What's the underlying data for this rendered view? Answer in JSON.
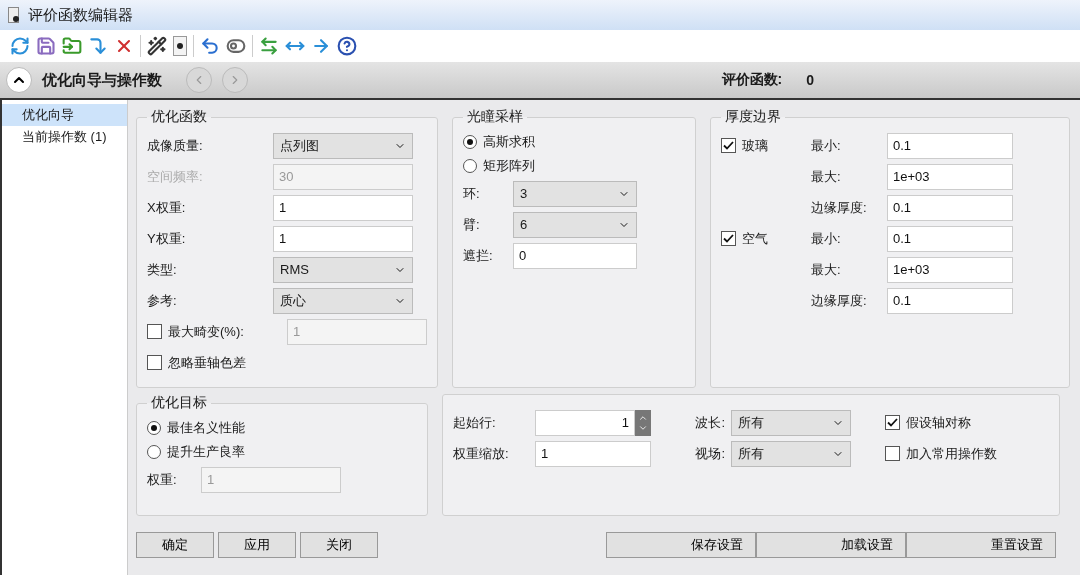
{
  "window": {
    "title": "评价函数编辑器"
  },
  "header": {
    "expanded": true,
    "title": "优化向导与操作数",
    "merit_label": "评价函数:",
    "merit_value": "0"
  },
  "sidebar": {
    "items": [
      {
        "label": "优化向导",
        "selected": true
      },
      {
        "label": "当前操作数 (1)",
        "selected": false
      }
    ]
  },
  "optimization_function": {
    "title": "优化函数",
    "rows": [
      {
        "kind": "select",
        "label": "成像质量:",
        "value": "点列图",
        "disabled": false
      },
      {
        "kind": "input",
        "label": "空间频率:",
        "value": "30",
        "disabled": true
      },
      {
        "kind": "input",
        "label": "X权重:",
        "value": "1",
        "disabled": false
      },
      {
        "kind": "input",
        "label": "Y权重:",
        "value": "1",
        "disabled": false
      },
      {
        "kind": "select",
        "label": "类型:",
        "value": "RMS",
        "disabled": false
      },
      {
        "kind": "select",
        "label": "参考:",
        "value": "质心",
        "disabled": false
      }
    ],
    "checks": [
      {
        "label": "最大畸变(%):",
        "checked": false,
        "value": "1"
      },
      {
        "label": "忽略垂轴色差",
        "checked": false
      }
    ]
  },
  "pupil_sampling": {
    "title": "光瞳采样",
    "options": [
      {
        "label": "高斯求积",
        "selected": true
      },
      {
        "label": "矩形阵列",
        "selected": false
      }
    ],
    "rows": [
      {
        "kind": "select",
        "label": "环:",
        "value": "3"
      },
      {
        "kind": "select",
        "label": "臂:",
        "value": "6"
      },
      {
        "kind": "input",
        "label": "遮拦:",
        "value": "0"
      }
    ]
  },
  "thickness_boundary": {
    "title": "厚度边界",
    "groups": [
      {
        "label": "玻璃",
        "checked": true,
        "rows": [
          {
            "label": "最小:",
            "value": "0.1"
          },
          {
            "label": "最大:",
            "value": "1e+03"
          },
          {
            "label": "边缘厚度:",
            "value": "0.1"
          }
        ]
      },
      {
        "label": "空气",
        "checked": true,
        "rows": [
          {
            "label": "最小:",
            "value": "0.1"
          },
          {
            "label": "最大:",
            "value": "1e+03"
          },
          {
            "label": "边缘厚度:",
            "value": "0.1"
          }
        ]
      }
    ]
  },
  "optimization_target": {
    "title": "优化目标",
    "options": [
      {
        "label": "最佳名义性能",
        "selected": true
      },
      {
        "label": "提升生产良率",
        "selected": false
      }
    ],
    "weight_label": "权重:",
    "weight_value": "1"
  },
  "settings": {
    "start_row_label": "起始行:",
    "start_row_value": "1",
    "weight_scale_label": "权重缩放:",
    "weight_scale_value": "1",
    "wavelength_label": "波长:",
    "wavelength_value": "所有",
    "field_label": "视场:",
    "field_value": "所有",
    "checks": [
      {
        "label": "假设轴对称",
        "checked": true
      },
      {
        "label": "加入常用操作数",
        "checked": false
      }
    ]
  },
  "buttons": [
    "确定",
    "应用",
    "关闭"
  ],
  "settings_buttons": [
    "保存设置",
    "加载设置",
    "重置设置"
  ]
}
